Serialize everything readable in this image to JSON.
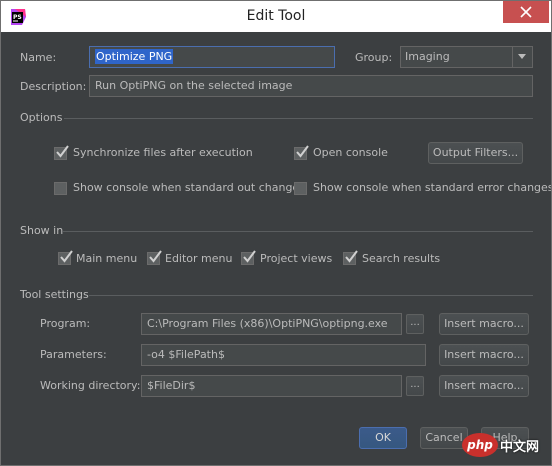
{
  "window": {
    "title": "Edit Tool"
  },
  "form": {
    "name_label": "Name:",
    "name_value": "Optimize PNG",
    "group_label": "Group:",
    "group_value": "Imaging",
    "description_label": "Description:",
    "description_value": "Run OptiPNG on the selected image"
  },
  "options": {
    "section_label": "Options",
    "sync_files": {
      "label": "Synchronize files after execution",
      "checked": true
    },
    "open_console": {
      "label": "Open console",
      "checked": true
    },
    "output_filters_button": "Output Filters...",
    "show_console_stdout": {
      "label": "Show console when standard out changes",
      "checked": false
    },
    "show_console_stderr": {
      "label": "Show console when standard error changes",
      "checked": false
    }
  },
  "show_in": {
    "section_label": "Show in",
    "main_menu": {
      "label": "Main menu",
      "checked": true
    },
    "editor_menu": {
      "label": "Editor menu",
      "checked": true
    },
    "project_views": {
      "label": "Project views",
      "checked": true
    },
    "search_results": {
      "label": "Search results",
      "checked": true
    }
  },
  "tool_settings": {
    "section_label": "Tool settings",
    "program_label": "Program:",
    "program_value": "C:\\Program Files (x86)\\OptiPNG\\optipng.exe",
    "parameters_label": "Parameters:",
    "parameters_value": "-o4 $FilePath$",
    "working_dir_label": "Working directory:",
    "working_dir_value": "$FileDir$",
    "browse_label": "...",
    "insert_macro_label": "Insert macro..."
  },
  "buttons": {
    "ok": "OK",
    "cancel": "Cancel",
    "help": "Help"
  },
  "watermark": {
    "logo": "php",
    "text": "中文网"
  },
  "colors": {
    "background": "#3c3f41",
    "text": "#bbbbbb",
    "selection": "#2f65ca",
    "close": "#c75050"
  }
}
